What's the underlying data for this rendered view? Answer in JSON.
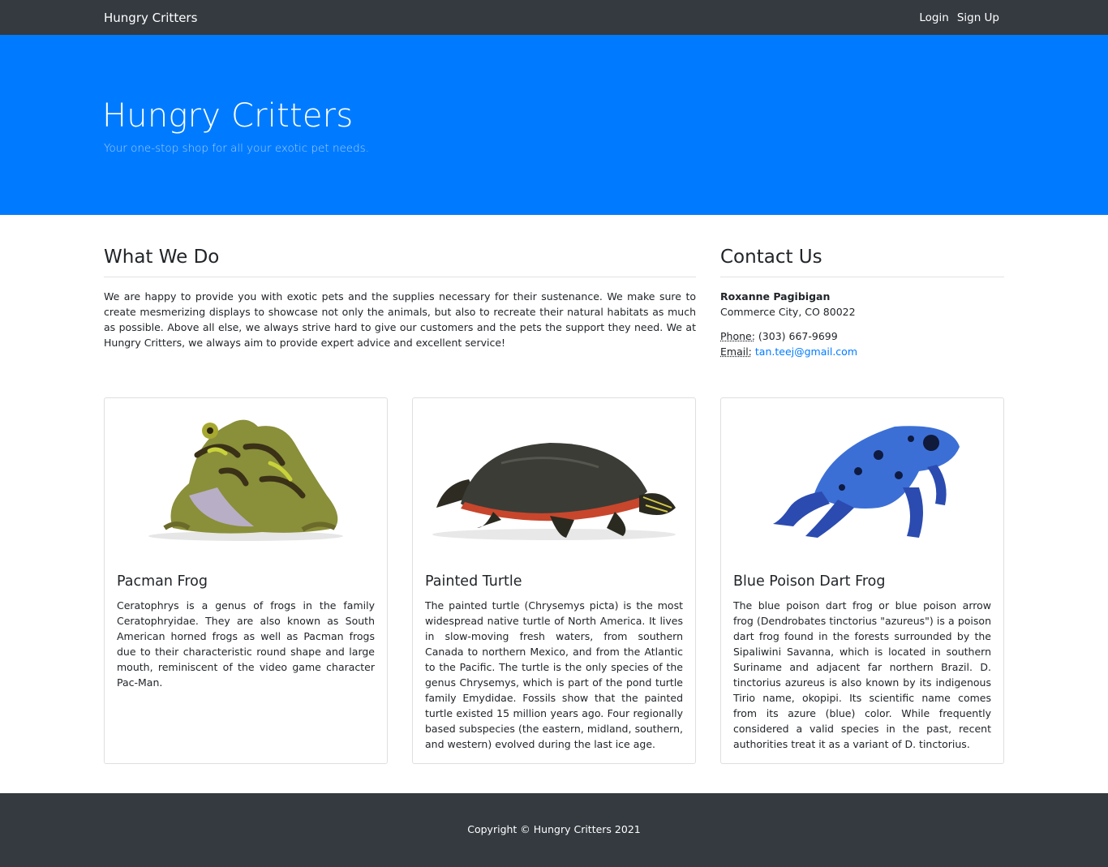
{
  "navbar": {
    "brand": "Hungry Critters",
    "login": "Login",
    "signup": "Sign Up"
  },
  "hero": {
    "title": "Hungry Critters",
    "subtitle": "Your one-stop shop for all your exotic pet needs."
  },
  "about": {
    "heading": "What We Do",
    "text": "We are happy to provide you with exotic pets and the supplies necessary for their sustenance. We make sure to create mesmerizing displays to showcase not only the animals, but also to recreate their natural habitats as much as possible. Above all else, we always strive hard to give our customers and the pets the support they need. We at Hungry Critters, we always aim to provide expert advice and excellent service!"
  },
  "contact": {
    "heading": "Contact Us",
    "name": "Roxanne Pagibigan",
    "address": "Commerce City, CO 80022",
    "phone_label": "Phone:",
    "phone": "(303) 667-9699",
    "email_label": "Email:",
    "email": "tan.teej@gmail.com"
  },
  "cards": [
    {
      "title": "Pacman Frog",
      "icon": "pacman-frog-image",
      "text": "Ceratophrys is a genus of frogs in the family Ceratophryidae. They are also known as South American horned frogs as well as Pacman frogs due to their characteristic round shape and large mouth, reminiscent of the video game character Pac-Man."
    },
    {
      "title": "Painted Turtle",
      "icon": "painted-turtle-image",
      "text": "The painted turtle (Chrysemys picta) is the most widespread native turtle of North America. It lives in slow-moving fresh waters, from southern Canada to northern Mexico, and from the Atlantic to the Pacific. The turtle is the only species of the genus Chrysemys, which is part of the pond turtle family Emydidae. Fossils show that the painted turtle existed 15 million years ago. Four regionally based subspecies (the eastern, midland, southern, and western) evolved during the last ice age."
    },
    {
      "title": "Blue Poison Dart Frog",
      "icon": "blue-poison-dart-frog-image",
      "text": "The blue poison dart frog or blue poison arrow frog (Dendrobates tinctorius \"azureus\") is a poison dart frog found in the forests surrounded by the Sipaliwini Savanna, which is located in southern Suriname and adjacent far northern Brazil. D. tinctorius azureus is also known by its indigenous Tirio name, okopipi. Its scientific name comes from its azure (blue) color. While frequently considered a valid species in the past, recent authorities treat it as a variant of D. tinctorius."
    }
  ],
  "footer": {
    "copyright": "Copyright © Hungry Critters 2021"
  },
  "colors": {
    "navbar": "#343a40",
    "hero": "#007bff",
    "link": "#007bff",
    "footer": "#343a40"
  }
}
